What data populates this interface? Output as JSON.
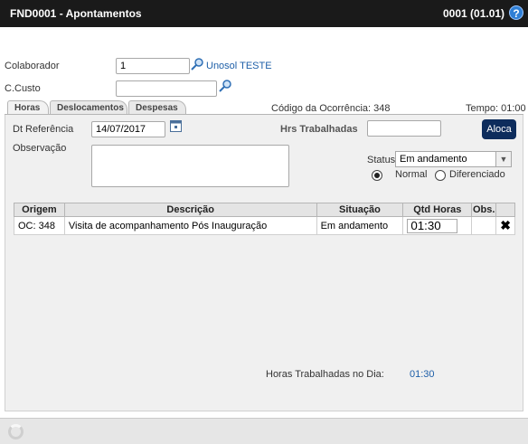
{
  "window": {
    "title": "FND0001 - Apontamentos",
    "code": "0001 (01.01)",
    "help": "?"
  },
  "form": {
    "colaborador_label": "Colaborador",
    "colaborador_value": "1",
    "colaborador_name": "Unosol TESTE",
    "ccusto_label": "C.Custo",
    "ccusto_value": ""
  },
  "tabs": [
    {
      "label": "Horas",
      "active": true
    },
    {
      "label": "Deslocamentos",
      "active": false
    },
    {
      "label": "Despesas",
      "active": false
    }
  ],
  "ocorrencia": "Código da Ocorrência: 348",
  "tempo": "Tempo: 01:00",
  "horas": {
    "dt_referencia_label": "Dt Referência",
    "dt_referencia_value": "14/07/2017",
    "hrs_trabalhadas_label": "Hrs Trabalhadas",
    "hrs_trabalhadas_value": "",
    "aloca_label": "Aloca",
    "observacao_label": "Observação",
    "observacao_value": "",
    "status_label": "Status",
    "status_value": "Em andamento",
    "radio_normal": "Normal",
    "radio_diferenciado": "Diferenciado",
    "selected_radio": "Normal"
  },
  "table": {
    "headers": [
      "Origem",
      "Descrição",
      "Situação",
      "Qtd Horas",
      "Obs."
    ],
    "rows": [
      {
        "origem": "OC: 348",
        "descricao": "Visita de acompanhamento Pós Inauguração",
        "situacao": "Em andamento",
        "qtd_horas": "01:30",
        "obs": ""
      }
    ]
  },
  "summary": {
    "label": "Horas Trabalhadas no Dia:",
    "value": "01:30"
  },
  "colors": {
    "titlebar": "#1a1a1a",
    "aloca_button": "#0d2c5c",
    "delete_icon": "#c00000",
    "link": "#1e5fa8"
  }
}
